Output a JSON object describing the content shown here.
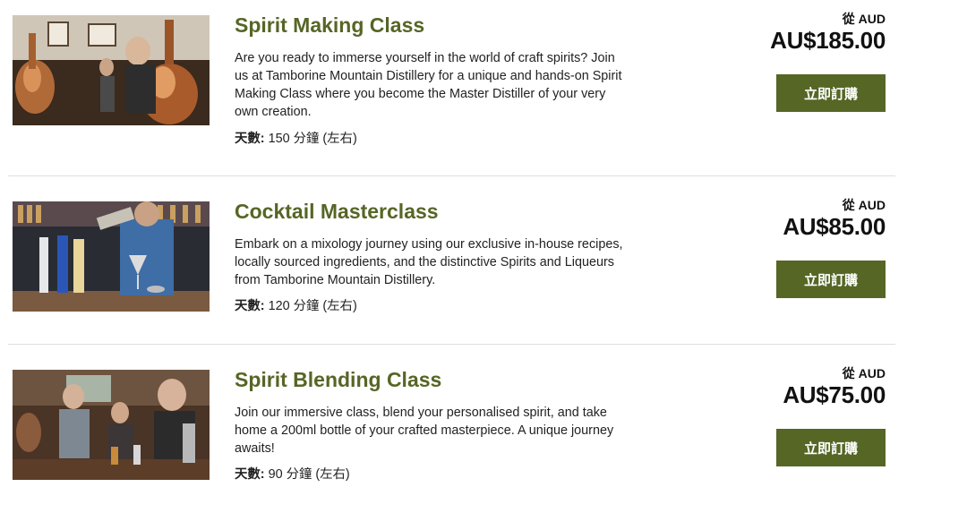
{
  "products": [
    {
      "title": "Spirit Making Class",
      "description": "Are you ready to immerse yourself in the world of craft spirits? Join us at Tamborine Mountain Distillery for a unique and hands-on Spirit Making Class where you become the Master Distiller of your very own creation.",
      "duration_label": "天數:",
      "duration_value": "150 分鐘 (左右)",
      "from_label": "從 AUD",
      "price": "AU$185.00",
      "button_label": "立即訂購",
      "image_subject": "copper-still-distillery-photo"
    },
    {
      "title": "Cocktail Masterclass",
      "description": "Embark on a mixology journey using our exclusive in-house recipes, locally sourced ingredients, and the distinctive Spirits and Liqueurs from Tamborine Mountain Distillery.",
      "duration_label": "天數:",
      "duration_value": "120 分鐘 (左右)",
      "from_label": "從 AUD",
      "price": "AU$85.00",
      "button_label": "立即訂購",
      "image_subject": "bartender-pouring-cocktail-photo"
    },
    {
      "title": "Spirit Blending Class",
      "description": "Join our immersive class, blend your personalised spirit, and take home a 200ml bottle of your crafted masterpiece. A unique journey awaits!",
      "duration_label": "天數:",
      "duration_value": "90 分鐘 (左右)",
      "from_label": "從 AUD",
      "price": "AU$75.00",
      "button_label": "立即訂購",
      "image_subject": "group-blending-spirits-photo"
    }
  ],
  "colors": {
    "accent": "#566625",
    "text": "#222222",
    "divider": "#dedede"
  }
}
